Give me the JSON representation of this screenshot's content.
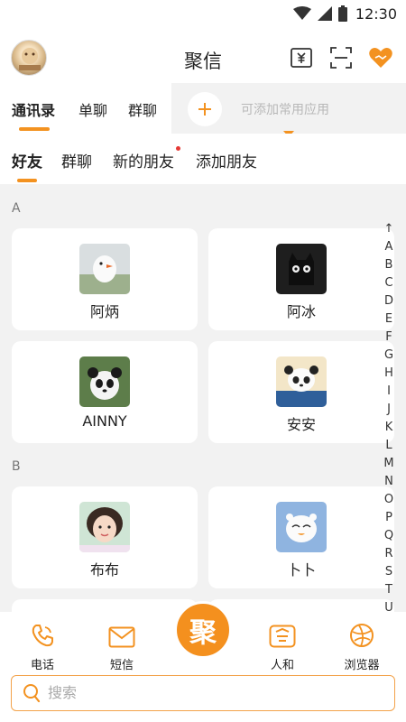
{
  "status": {
    "time": "12:30"
  },
  "header": {
    "title": "聚信"
  },
  "tabs1": {
    "items": [
      {
        "label": "通讯录",
        "active": true
      },
      {
        "label": "单聊",
        "active": false
      },
      {
        "label": "群聊",
        "active": false
      }
    ],
    "add_hint": "可添加常用应用"
  },
  "tabs2": {
    "items": [
      {
        "label": "好友",
        "active": true
      },
      {
        "label": "群聊",
        "active": false
      },
      {
        "label": "新的朋友",
        "active": false,
        "badge": true
      },
      {
        "label": "添加朋友",
        "active": false
      }
    ]
  },
  "contacts": {
    "sections": [
      {
        "letter": "A",
        "items": [
          {
            "name": "阿炳"
          },
          {
            "name": "阿冰"
          },
          {
            "name": "AINNY"
          },
          {
            "name": "安安"
          }
        ]
      },
      {
        "letter": "B",
        "items": [
          {
            "name": "布布"
          },
          {
            "name": "卜卜"
          }
        ]
      }
    ]
  },
  "index_bar": [
    "↑",
    "A",
    "B",
    "C",
    "D",
    "E",
    "F",
    "G",
    "H",
    "I",
    "J",
    "K",
    "L",
    "M",
    "N",
    "O",
    "P",
    "Q",
    "R",
    "S",
    "T",
    "U"
  ],
  "bottom_nav": {
    "items": [
      {
        "label": "电话"
      },
      {
        "label": "短信"
      },
      {
        "label": "人和"
      },
      {
        "label": "浏览器"
      }
    ],
    "center_label": "聚"
  },
  "search": {
    "placeholder": "搜索"
  },
  "colors": {
    "accent": "#f39220",
    "badge": "#e53935"
  }
}
